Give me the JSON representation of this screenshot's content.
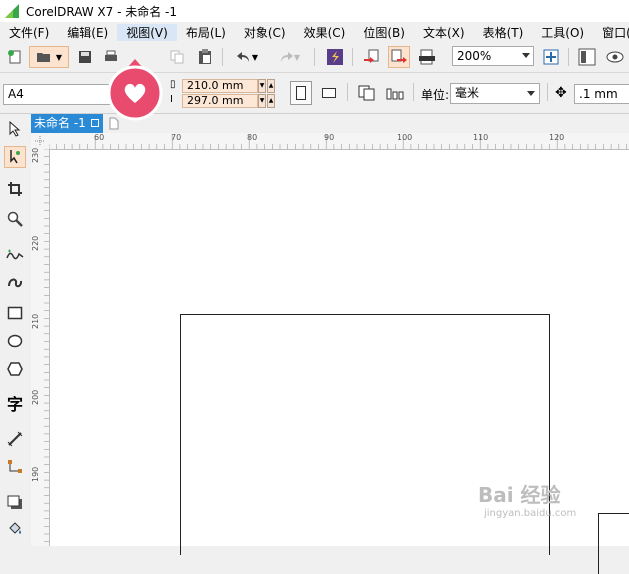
{
  "window": {
    "title": "CorelDRAW X7 - 未命名 -1"
  },
  "menu": [
    {
      "label": "文件(F)",
      "active": false
    },
    {
      "label": "编辑(E)",
      "active": false
    },
    {
      "label": "视图(V)",
      "active": true
    },
    {
      "label": "布局(L)",
      "active": false
    },
    {
      "label": "对象(C)",
      "active": false
    },
    {
      "label": "效果(C)",
      "active": false
    },
    {
      "label": "位图(B)",
      "active": false
    },
    {
      "label": "文本(X)",
      "active": false
    },
    {
      "label": "表格(T)",
      "active": false
    },
    {
      "label": "工具(O)",
      "active": false
    },
    {
      "label": "窗口(W)",
      "active": false
    }
  ],
  "standard_toolbar": {
    "zoom_value": "200%"
  },
  "property_bar": {
    "page_size": "A4",
    "width": "210.0 mm",
    "height": "297.0 mm",
    "unit_label": "单位:",
    "unit_value": "毫米",
    "nudge_value": ".1 mm"
  },
  "document_tab": {
    "label": "未命名 -1"
  },
  "rulers": {
    "horizontal": [
      "60",
      "70",
      "80",
      "90",
      "100",
      "110",
      "120"
    ],
    "vertical": [
      "230",
      "220",
      "210",
      "200",
      "190"
    ]
  },
  "watermark": {
    "main": "Bai 经验",
    "sub": "jingyan.baidu.com"
  },
  "colors": {
    "accent": "#2b8ad6",
    "badge": "#e94b6e",
    "dim_field": "#fde7d6"
  }
}
